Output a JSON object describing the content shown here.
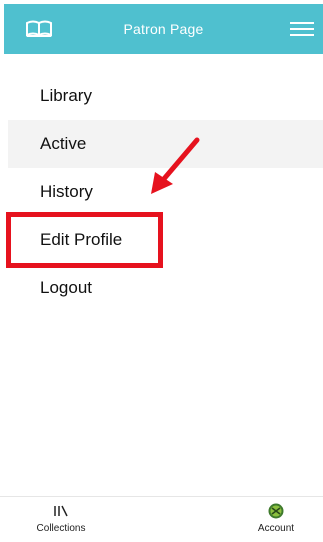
{
  "header": {
    "title": "Patron Page",
    "background_color": "#4fc0cf",
    "left_icon": "open-book-icon",
    "right_icon": "hamburger-menu-icon"
  },
  "menu": {
    "items": [
      {
        "label": "Library"
      },
      {
        "label": "Active",
        "selected": true
      },
      {
        "label": "History"
      },
      {
        "label": "Edit Profile",
        "highlighted": true
      },
      {
        "label": "Logout"
      }
    ]
  },
  "annotation": {
    "color": "#e6121e",
    "arrow_icon": "red-arrow-icon"
  },
  "bottom_nav": {
    "collections": {
      "label": "Collections",
      "icon": "books-stack-icon"
    },
    "account": {
      "label": "Account",
      "icon": "account-avatar-icon"
    }
  }
}
